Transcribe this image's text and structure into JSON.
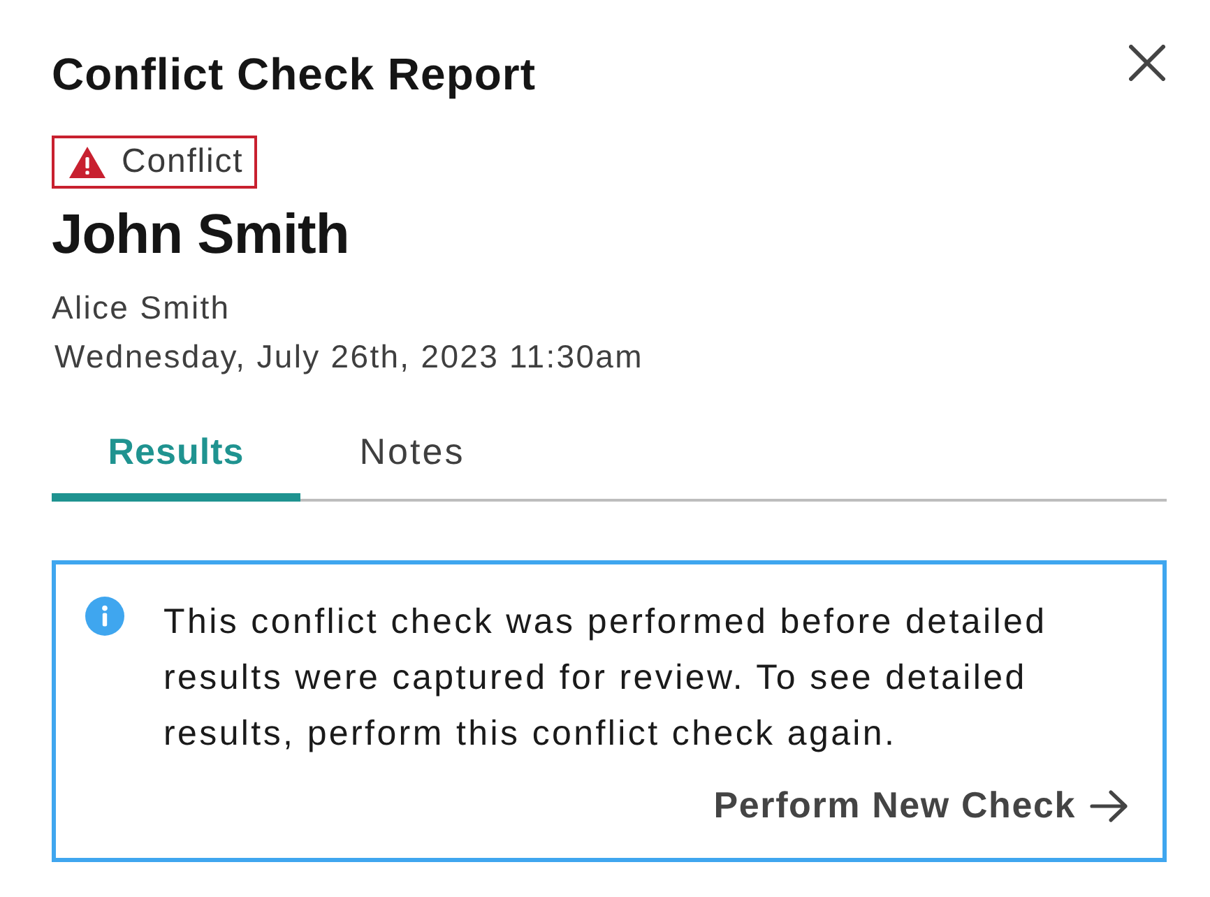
{
  "dialog": {
    "title": "Conflict Check Report"
  },
  "status_badge": {
    "kind": "conflict",
    "label": "Conflict"
  },
  "record": {
    "name": "John Smith",
    "requested_by": "Alice Smith",
    "date": "Wednesday, July 26th, 2023 11:30am"
  },
  "tabs": [
    {
      "label": "Results",
      "selected": true
    },
    {
      "label": "Notes",
      "selected": false
    }
  ],
  "notice": {
    "kind": "info",
    "message": "This conflict check was performed before detailed results were captured for review. To see detailed results, perform this conflict check again.",
    "action": "Perform New Check"
  }
}
